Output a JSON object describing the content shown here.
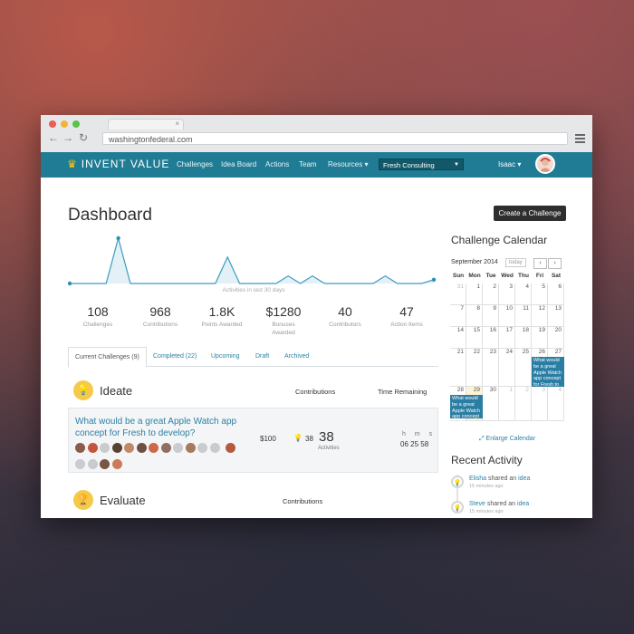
{
  "browser": {
    "url": "washingtonfederal.com",
    "tab_close": "×",
    "nav": {
      "back": "←",
      "forward": "→",
      "reload": "↻"
    },
    "traffic_colors": [
      "#ec5b55",
      "#f2b437",
      "#59c34b"
    ]
  },
  "topnav": {
    "logo_text": "INVENT VALUE",
    "logo_icon": "crown-icon",
    "links": [
      "Challenges",
      "Idea Board",
      "Actions",
      "Team",
      "Resources ▾"
    ],
    "company_select": "Fresh Consulting",
    "user_name": "Isaac ▾",
    "accent_color": "#1f7c94"
  },
  "page": {
    "title": "Dashboard",
    "create_button": "Create a Challenge"
  },
  "activity_chart": {
    "label": "Activities in last 30 days",
    "values": [
      0,
      0,
      0,
      0,
      12,
      0,
      0,
      0,
      0,
      0,
      0,
      0,
      0,
      7,
      0,
      0,
      0,
      0,
      2,
      0,
      2,
      0,
      0,
      0,
      0,
      0,
      2,
      0,
      0,
      0,
      1
    ]
  },
  "stats": [
    {
      "value": "108",
      "label": "Challenges"
    },
    {
      "value": "968",
      "label": "Contributions"
    },
    {
      "value": "1.8K",
      "label": "Points Awarded"
    },
    {
      "value": "$1280",
      "label": "Bonuses Awarded"
    },
    {
      "value": "40",
      "label": "Contributors"
    },
    {
      "value": "47",
      "label": "Action Items"
    }
  ],
  "tabs": [
    "Current Challenges (9)",
    "Completed (22)",
    "Upcoming",
    "Draft",
    "Archived"
  ],
  "ideate": {
    "title": "Ideate",
    "col_contributions": "Contributions",
    "col_time": "Time Remaining",
    "card": {
      "question": "What would be a great Apple Watch app concept for Fresh to develop?",
      "price": "$100",
      "ideas": "38",
      "activities": "38",
      "activities_label": "Activities",
      "time_labels": "h m s",
      "time_values": "06 25 58"
    }
  },
  "evaluate": {
    "title": "Evaluate",
    "col_contributions": "Contributions"
  },
  "calendar": {
    "title": "Challenge Calendar",
    "month": "September 2014",
    "today_label": "today",
    "prev": "‹",
    "next": "›",
    "days": [
      "Sun",
      "Mon",
      "Tue",
      "Wed",
      "Thu",
      "Fri",
      "Sat"
    ],
    "weeks": [
      [
        "31",
        "1",
        "2",
        "3",
        "4",
        "5",
        "6"
      ],
      [
        "7",
        "8",
        "9",
        "10",
        "11",
        "12",
        "13"
      ],
      [
        "14",
        "15",
        "16",
        "17",
        "18",
        "19",
        "20"
      ],
      [
        "21",
        "22",
        "23",
        "24",
        "25",
        "26",
        "27"
      ],
      [
        "28",
        "29",
        "30",
        "1",
        "2",
        "3",
        "4"
      ]
    ],
    "event_text": "What would be a great Apple Watch app concept for Fresh to develop?",
    "enlarge": "Enlarge Calendar"
  },
  "recent": {
    "title": "Recent Activity",
    "items": [
      {
        "user": "Elisha",
        "action": " shared an ",
        "object": "idea",
        "time": "15 minutes ago"
      },
      {
        "user": "Steve",
        "action": " shared an ",
        "object": "idea",
        "time": "15 minutes ago"
      }
    ]
  }
}
